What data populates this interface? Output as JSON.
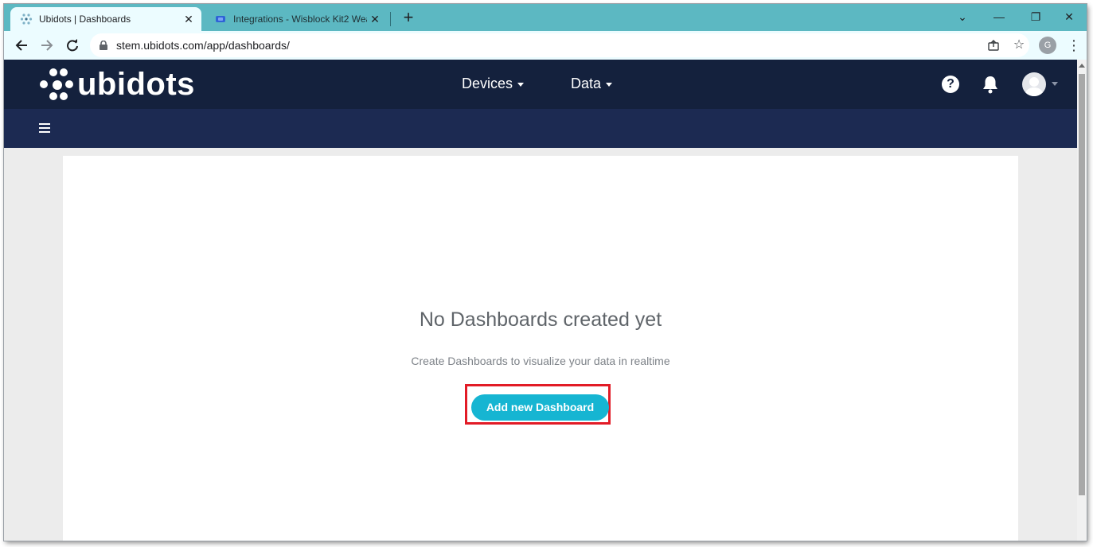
{
  "browser": {
    "tabs": [
      {
        "title": "Ubidots | Dashboards",
        "active": true,
        "favicon": "ubidots-icon"
      },
      {
        "title": "Integrations - Wisblock Kit2  Wea",
        "active": false,
        "favicon": "rak-icon"
      }
    ],
    "new_tab_label": "+",
    "window_controls": {
      "tab_search": "⌄",
      "minimize": "—",
      "restore": "❐",
      "close": "✕"
    },
    "url": "stem.ubidots.com/app/dashboards/",
    "profile_initial": "G"
  },
  "app": {
    "logo_text": "ubidots",
    "nav": [
      {
        "label": "Devices"
      },
      {
        "label": "Data"
      }
    ],
    "help_glyph": "?"
  },
  "main": {
    "empty_title": "No Dashboards created yet",
    "empty_subtitle": "Create Dashboards to visualize your data in realtime",
    "add_button_label": "Add new Dashboard"
  },
  "colors": {
    "tab_strip": "#5cb8c2",
    "app_nav": "#14213d",
    "app_subnav": "#1c2a52",
    "button": "#16b5d2",
    "highlight": "#e21b26"
  }
}
